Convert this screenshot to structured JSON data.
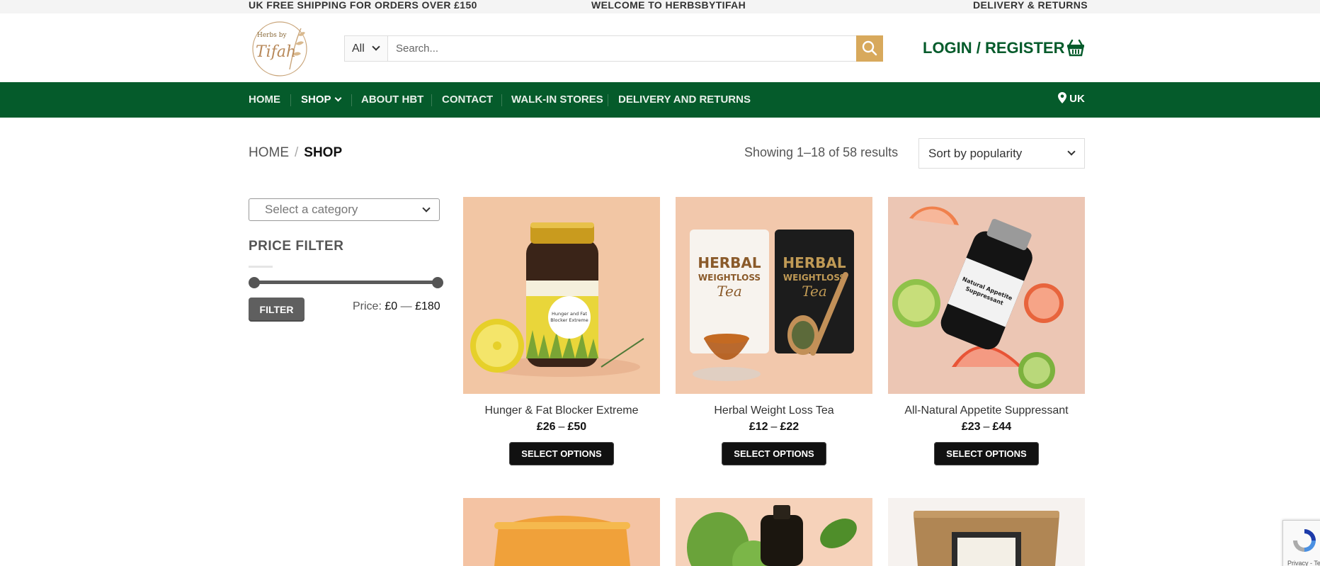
{
  "topbar": {
    "left": "UK FREE SHIPPING FOR ORDERS OVER £150",
    "center": "WELCOME TO HERBSBYTIFAH",
    "right": "DELIVERY & RETURNS"
  },
  "header": {
    "logo_text_top": "Herbs by",
    "logo_text_main": "Tifah",
    "search": {
      "category": "All",
      "placeholder": "Search..."
    },
    "login_label": "LOGIN / REGISTER"
  },
  "nav": {
    "items": [
      {
        "label": "HOME"
      },
      {
        "label": "SHOP"
      },
      {
        "label": "ABOUT HBT"
      },
      {
        "label": "CONTACT"
      },
      {
        "label": "WALK-IN STORES"
      },
      {
        "label": "DELIVERY AND RETURNS"
      }
    ],
    "region": "UK"
  },
  "breadcrumb": {
    "home": "HOME",
    "separator": "/",
    "current": "SHOP"
  },
  "results_text": "Showing 1–18 of 58 results",
  "sort": {
    "selected": "Sort by popularity"
  },
  "sidebar": {
    "category_placeholder": "Select a category",
    "price_filter_title": "PRICE FILTER",
    "filter_button": "FILTER",
    "price_label": "Price:",
    "price_min": "£0",
    "price_sep": "—",
    "price_max": "£180"
  },
  "products": [
    {
      "title": "Hunger & Fat Blocker Extreme",
      "price_min": "£26",
      "price_max": "£50",
      "button": "SELECT OPTIONS",
      "label": "Hunger and Fat Blocker Extreme"
    },
    {
      "title": "Herbal Weight Loss Tea",
      "price_min": "£12",
      "price_max": "£22",
      "button": "SELECT OPTIONS",
      "label_main": "HERBAL",
      "label_sub": "WEIGHTLOSS",
      "label_script": "Tea"
    },
    {
      "title": "All-Natural Appetite Suppressant",
      "price_min": "£23",
      "price_max": "£44",
      "button": "SELECT OPTIONS",
      "label": "Natural Appetite Suppressant"
    }
  ],
  "recaptcha_text": "Privacy - Te",
  "colors": {
    "brand_green": "#055b2b",
    "search_gold": "#d8a95c",
    "button_dark": "#111111"
  }
}
